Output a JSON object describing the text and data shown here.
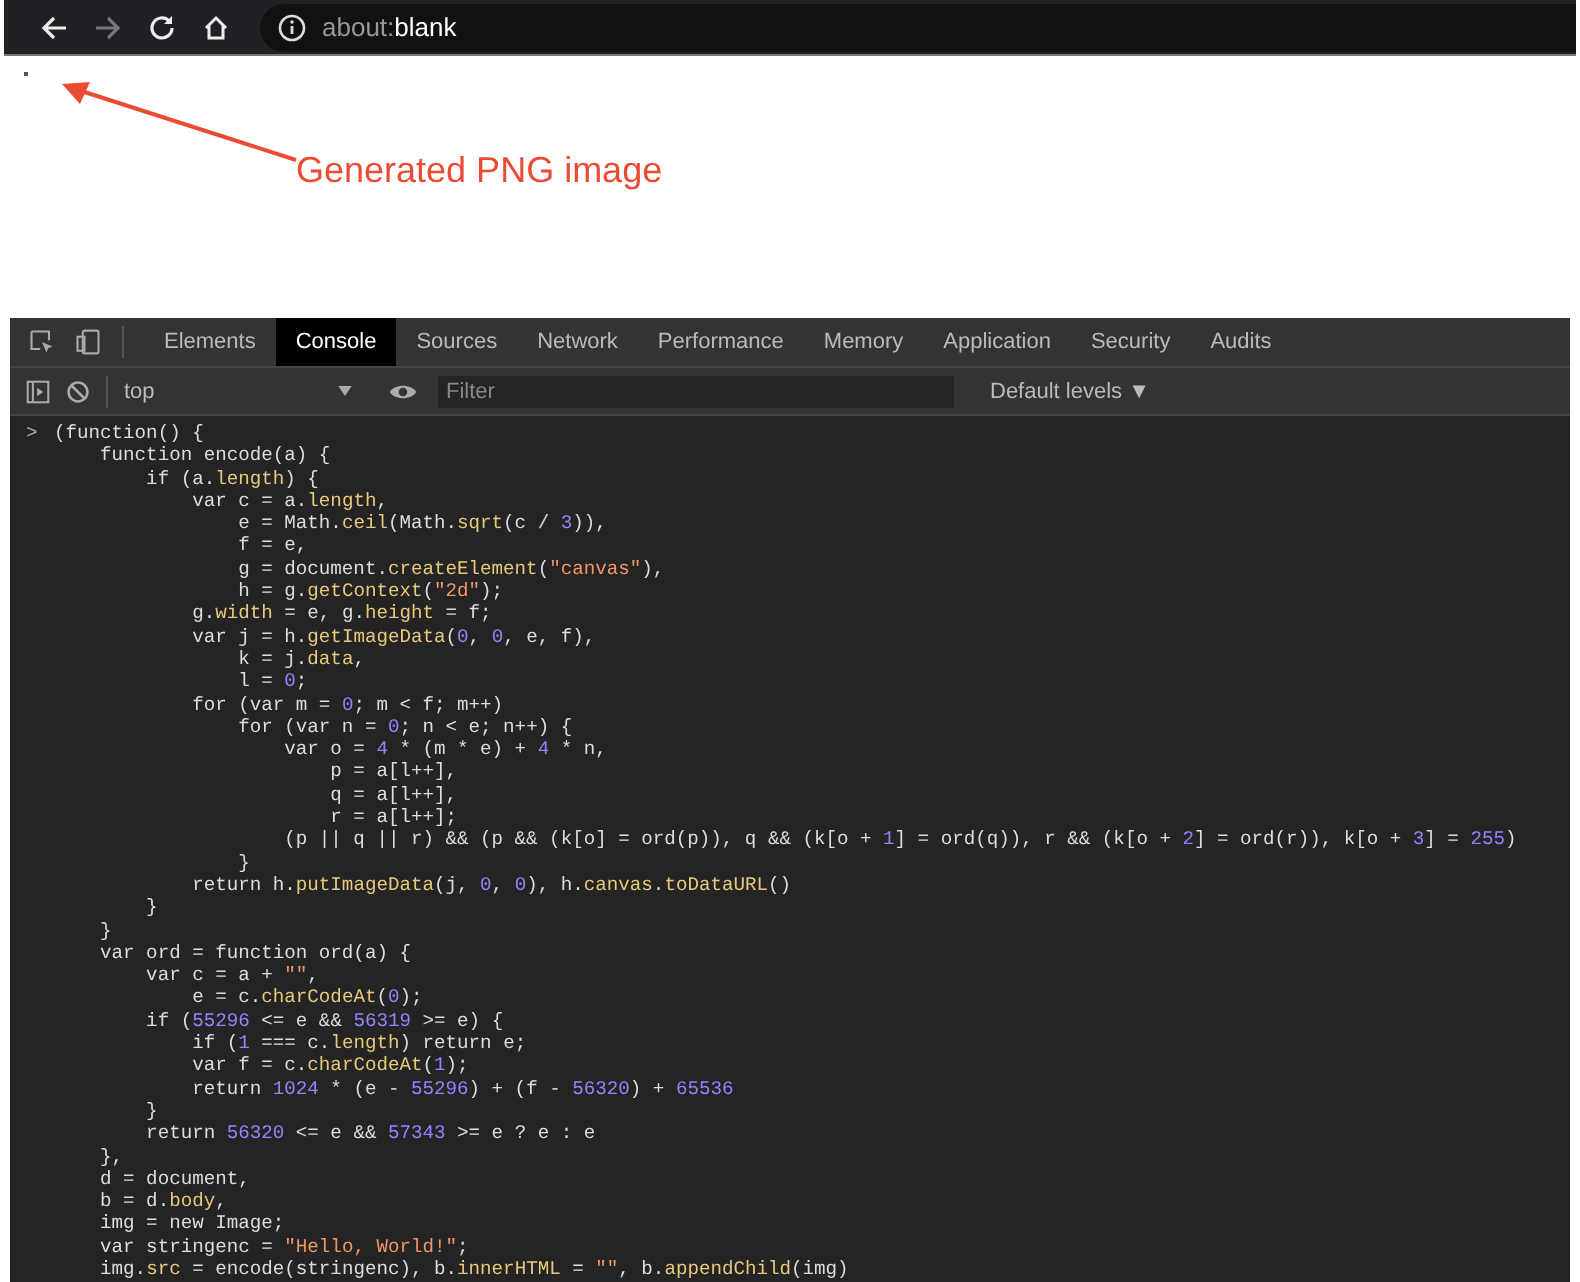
{
  "browser": {
    "back_disabled": false,
    "forward_disabled": true,
    "url_prefix": "about:",
    "url_host": "blank"
  },
  "annotation": {
    "label": "Generated PNG image"
  },
  "devtools": {
    "tabs": [
      {
        "label": "Elements",
        "selected": false
      },
      {
        "label": "Console",
        "selected": true
      },
      {
        "label": "Sources",
        "selected": false
      },
      {
        "label": "Network",
        "selected": false
      },
      {
        "label": "Performance",
        "selected": false
      },
      {
        "label": "Memory",
        "selected": false
      },
      {
        "label": "Application",
        "selected": false
      },
      {
        "label": "Security",
        "selected": false
      },
      {
        "label": "Audits",
        "selected": false
      }
    ],
    "context": "top",
    "filter": {
      "placeholder": "Filter"
    },
    "levels": "Default levels ▼",
    "prompt": ">",
    "code_lines": [
      "(function() {",
      "    function encode(a) {",
      "        if (a.length) {",
      "            var c = a.length,",
      "                e = Math.ceil(Math.sqrt(c / 3)),",
      "                f = e,",
      "                g = document.createElement(\"canvas\"),",
      "                h = g.getContext(\"2d\");",
      "            g.width = e, g.height = f;",
      "            var j = h.getImageData(0, 0, e, f),",
      "                k = j.data,",
      "                l = 0;",
      "            for (var m = 0; m < f; m++)",
      "                for (var n = 0; n < e; n++) {",
      "                    var o = 4 * (m * e) + 4 * n,",
      "                        p = a[l++],",
      "                        q = a[l++],",
      "                        r = a[l++];",
      "                    (p || q || r) && (p && (k[o] = ord(p)), q && (k[o + 1] = ord(q)), r && (k[o + 2] = ord(r)), k[o + 3] = 255)",
      "                }",
      "            return h.putImageData(j, 0, 0), h.canvas.toDataURL()",
      "        }",
      "    }",
      "    var ord = function ord(a) {",
      "        var c = a + \"\",",
      "            e = c.charCodeAt(0);",
      "        if (55296 <= e && 56319 >= e) {",
      "            if (1 === c.length) return e;",
      "            var f = c.charCodeAt(1);",
      "            return 1024 * (e - 55296) + (f - 56320) + 65536",
      "        }",
      "        return 56320 <= e && 57343 >= e ? e : e",
      "    },",
      "    d = document,",
      "    b = d.body,",
      "    img = new Image;",
      "    var stringenc = \"Hello, World!\";",
      "    img.src = encode(stringenc), b.innerHTML = \"\", b.appendChild(img)"
    ]
  }
}
